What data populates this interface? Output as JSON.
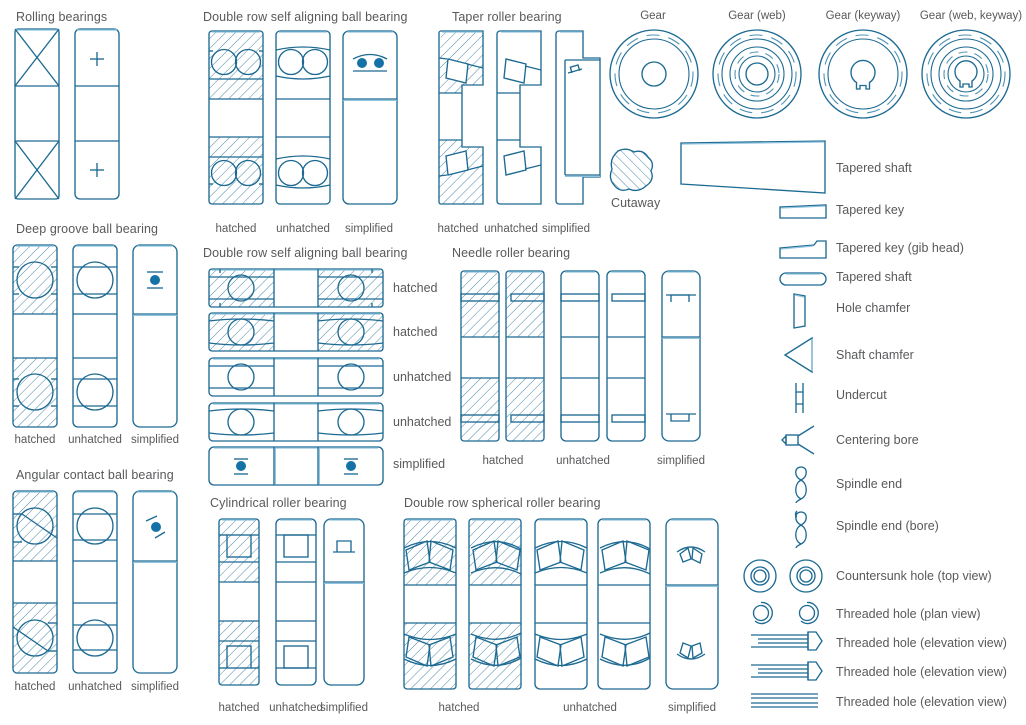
{
  "meta": {
    "palette": {
      "stroke": "#1d6a92",
      "highlight": "#8fc3de",
      "label": "#58595b",
      "fill": "#1472a6",
      "background": "#ffffff"
    }
  },
  "groups": {
    "rolling_bearings": {
      "title": "Rolling bearings"
    },
    "deep_groove": {
      "title": "Deep groove ball bearing",
      "variants": [
        "hatched",
        "unhatched",
        "simplified"
      ]
    },
    "angular_contact": {
      "title": "Angular contact ball bearing",
      "variants": [
        "hatched",
        "unhatched",
        "simplified"
      ]
    },
    "double_row_vertical": {
      "title": "Double row self aligning ball bearing",
      "variants": [
        "hatched",
        "unhatched",
        "simplified"
      ]
    },
    "double_row_horizontal": {
      "title": "Double row self aligning ball bearing",
      "variants": [
        "hatched",
        "hatched",
        "unhatched",
        "unhatched",
        "simplified"
      ]
    },
    "cylindrical_roller": {
      "title": "Cylindrical roller bearing",
      "variants": [
        "hatched",
        "unhatched",
        "simplified"
      ]
    },
    "taper_roller": {
      "title": "Taper roller bearing",
      "variants": [
        "hatched",
        "unhatched",
        "simplified"
      ]
    },
    "needle_roller": {
      "title": "Needle roller bearing",
      "variants": [
        "hatched",
        "unhatched",
        "simplified"
      ]
    },
    "spherical_roller": {
      "title": "Double row spherical roller bearing",
      "variants": [
        "hatched",
        "unhatched",
        "simplified"
      ]
    },
    "gears": {
      "labels": [
        "Gear",
        "Gear (web)",
        "Gear (keyway)",
        "Gear (web, keyway)"
      ]
    },
    "cutaway": {
      "title": "Cutaway"
    }
  },
  "list": [
    {
      "label": "Tapered shaft"
    },
    {
      "label": "Tapered key"
    },
    {
      "label": "Tapered key (gib head)"
    },
    {
      "label": "Tapered shaft"
    },
    {
      "label": "Hole chamfer"
    },
    {
      "label": "Shaft chamfer"
    },
    {
      "label": "Undercut"
    },
    {
      "label": "Centering bore"
    },
    {
      "label": "Spindle end"
    },
    {
      "label": "Spindle end (bore)"
    },
    {
      "label": "Countersunk hole (top view)"
    },
    {
      "label": "Threaded hole (plan view)"
    },
    {
      "label": "Threaded hole (elevation view)"
    },
    {
      "label": "Threaded hole (elevation view)"
    },
    {
      "label": "Threaded hole (elevation view)"
    }
  ]
}
